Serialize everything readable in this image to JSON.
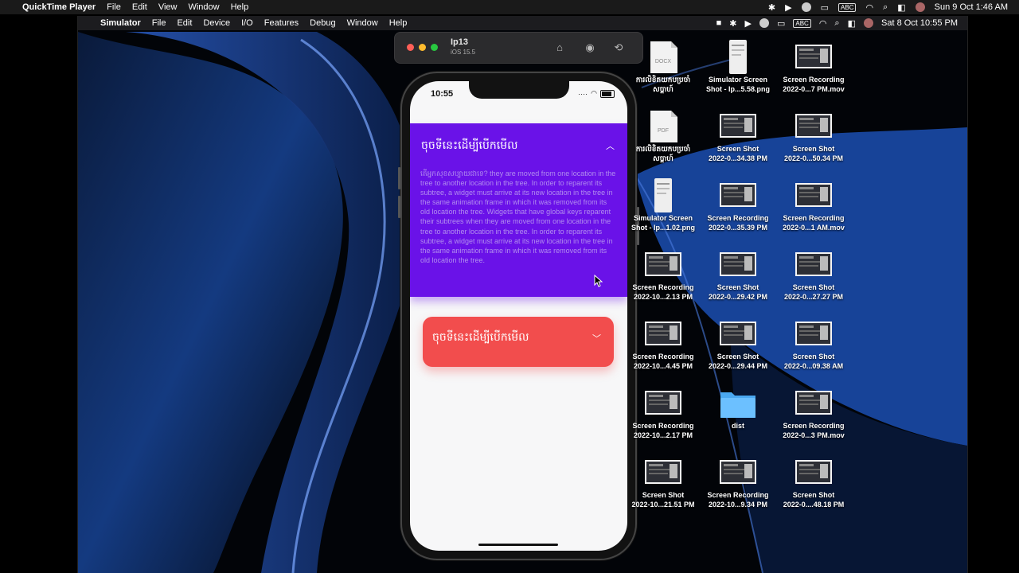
{
  "quicktime_menubar": {
    "app_name": "QuickTime Player",
    "items": [
      "File",
      "Edit",
      "View",
      "Window",
      "Help"
    ],
    "input_source": "ABC",
    "clock": "Sun 9 Oct  1:46 AM"
  },
  "simulator_menubar": {
    "app_name": "Simulator",
    "items": [
      "File",
      "Edit",
      "Device",
      "I/O",
      "Features",
      "Debug",
      "Window",
      "Help"
    ],
    "input_source": "ABC",
    "clock": "Sat 8 Oct  10:55 PM"
  },
  "simulator_window": {
    "device_name": "Ip13",
    "os_version": "iOS 15.5",
    "icons": [
      "home-icon",
      "screenshot-icon",
      "rotate-icon"
    ]
  },
  "phone": {
    "status_time": "10:55",
    "panel_expanded": {
      "title": "ចុចទីនេះដើម្បីបើកមើល",
      "body": "តើអ្នកសុខសប្បាយជាទេ? they are moved from one location in the tree to another location in the tree. In order to reparent its subtree, a widget must arrive at its new location in the tree in the same animation frame in which it was removed from its old location the tree. Widgets that have global keys reparent their subtrees when they are moved from one location in the tree to another location in the tree. In order to reparent its subtree, a widget must arrive at its new location in the tree in the same animation frame in which it was removed from its old location the tree.",
      "color": "#6a12e8"
    },
    "panel_collapsed": {
      "title": "ចុចទីនេះដើម្បីបើកមើល",
      "color": "#f24d4d"
    }
  },
  "desktop_items": [
    {
      "line1": "ការលិខិតយកបប្រចាំ",
      "line2": "សប្តាហ៍",
      "kind": "docx",
      "ext": "DOCX"
    },
    {
      "line1": "Simulator Screen",
      "line2": "Shot - Ip...5.58.png",
      "kind": "phone"
    },
    {
      "line1": "Screen Recording",
      "line2": "2022-0...7 PM.mov",
      "kind": "shot"
    },
    {
      "line1": "ការលិខិតយកបប្រចាំ",
      "line2": "សប្តាហ៍",
      "kind": "pdf",
      "ext": "PDF"
    },
    {
      "line1": "Screen Shot",
      "line2": "2022-0...34.38 PM",
      "kind": "shot"
    },
    {
      "line1": "Screen Shot",
      "line2": "2022-0...50.34 PM",
      "kind": "shot"
    },
    {
      "line1": "Simulator Screen",
      "line2": "Shot - Ip...1.02.png",
      "kind": "phone"
    },
    {
      "line1": "Screen Recording",
      "line2": "2022-0...35.39 PM",
      "kind": "shot"
    },
    {
      "line1": "Screen Recording",
      "line2": "2022-0...1 AM.mov",
      "kind": "shot"
    },
    {
      "line1": "Screen Recording",
      "line2": "2022-10...2.13 PM",
      "kind": "shot"
    },
    {
      "line1": "Screen Shot",
      "line2": "2022-0...29.42 PM",
      "kind": "shot"
    },
    {
      "line1": "Screen Shot",
      "line2": "2022-0...27.27 PM",
      "kind": "shot"
    },
    {
      "line1": "Screen Recording",
      "line2": "2022-10...4.45 PM",
      "kind": "shot"
    },
    {
      "line1": "Screen Shot",
      "line2": "2022-0...29.44 PM",
      "kind": "shot"
    },
    {
      "line1": "Screen Shot",
      "line2": "2022-0...09.38 AM",
      "kind": "shot"
    },
    {
      "line1": "Screen Recording",
      "line2": "2022-10...2.17 PM",
      "kind": "shot"
    },
    {
      "line1": "dist",
      "line2": "",
      "kind": "folder"
    },
    {
      "line1": "Screen Recording",
      "line2": "2022-0...3 PM.mov",
      "kind": "shot"
    },
    {
      "line1": "Screen Shot",
      "line2": "2022-10...21.51 PM",
      "kind": "shot"
    },
    {
      "line1": "Screen Recording",
      "line2": "2022-10...9.34 PM",
      "kind": "shot"
    },
    {
      "line1": "Screen Shot",
      "line2": "2022-0....48.18 PM",
      "kind": "shot"
    }
  ]
}
